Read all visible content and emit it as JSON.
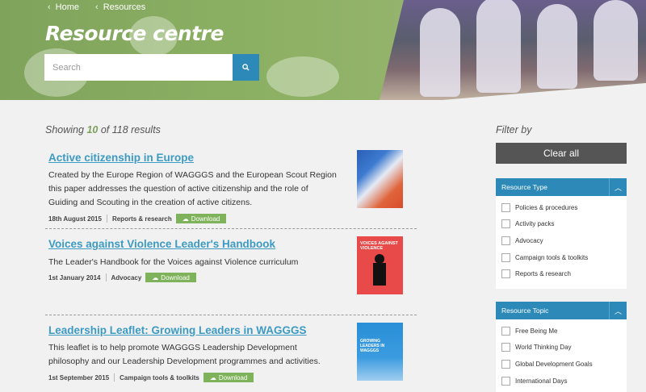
{
  "breadcrumb": {
    "home": "Home",
    "resources": "Resources"
  },
  "page_title": "Resource centre",
  "search": {
    "placeholder": "Search"
  },
  "results_summary": {
    "prefix": "Showing ",
    "shown": "10",
    "suffix": " of 118 results"
  },
  "results": [
    {
      "title": "Active citizenship in Europe",
      "description": "Created by the Europe Region of WAGGGS and the European Scout Region this paper addresses the question of active citizenship and the role of Guiding and Scouting in the creation of active citizens.",
      "date": "18th August 2015",
      "category": "Reports & research",
      "download_label": "Download"
    },
    {
      "title": "Voices against Violence Leader's Handbook",
      "description": "The Leader's Handbook for the Voices against Violence curriculum",
      "date": "1st January 2014",
      "category": "Advocacy",
      "download_label": "Download",
      "thumb_text": "VOICES AGAINST VIOLENCE"
    },
    {
      "title": "Leadership Leaflet: Growing Leaders in WAGGGS",
      "description": "This leaflet is to help promote WAGGGS Leadership Development philosophy and our Leadership Development programmes and activities.",
      "date": "1st September 2015",
      "category": "Campaign tools & toolkits",
      "download_label": "Download",
      "thumb_text": "GROWING LEADERS IN WAGGGS"
    }
  ],
  "sidebar": {
    "filter_label": "Filter by",
    "clear_all": "Clear all",
    "resource_type": {
      "heading": "Resource Type",
      "options": [
        "Policies & procedures",
        "Activity packs",
        "Advocacy",
        "Campaign tools & toolkits",
        "Reports & research"
      ]
    },
    "resource_topic": {
      "heading": "Resource Topic",
      "options": [
        "Free Being Me",
        "World Thinking Day",
        "Global Development Goals",
        "International Days"
      ]
    }
  },
  "colors": {
    "accent_blue": "#2d8ab8",
    "link_blue": "#3c9ac3",
    "download_green": "#7fb35b",
    "count_green": "#7ba05b"
  }
}
